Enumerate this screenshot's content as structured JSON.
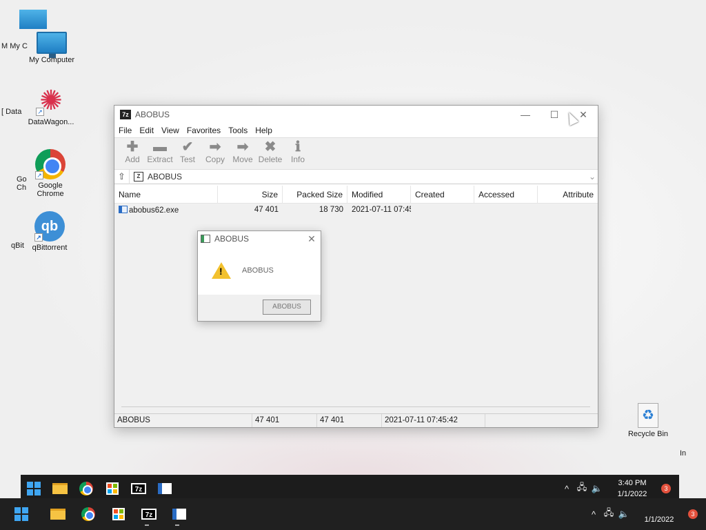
{
  "desktop": {
    "icons": [
      {
        "label": "My Computer"
      },
      {
        "label": "DataWagon..."
      },
      {
        "label": "Google Chrome"
      },
      {
        "label": "qBittorrent"
      },
      {
        "label": "Recycle Bin"
      }
    ],
    "ghost_labels": [
      "M My C",
      "[ Data",
      "Go Ch",
      "qBit",
      "In"
    ]
  },
  "window": {
    "title": "ABOBUS",
    "app_badge": "7z",
    "controls": {
      "minimize": "—",
      "maximize": "☐",
      "close": "✕"
    },
    "menu": [
      "File",
      "Edit",
      "View",
      "Favorites",
      "Tools",
      "Help"
    ],
    "toolbar": [
      {
        "label": "Add",
        "icon": "plus-icon",
        "glyph": "✚"
      },
      {
        "label": "Extract",
        "icon": "minus-icon",
        "glyph": "▬"
      },
      {
        "label": "Test",
        "icon": "check-icon",
        "glyph": "✔"
      },
      {
        "label": "Copy",
        "icon": "copy-arrow-icon",
        "glyph": "➡"
      },
      {
        "label": "Move",
        "icon": "move-arrow-icon",
        "glyph": "➡"
      },
      {
        "label": "Delete",
        "icon": "delete-x-icon",
        "glyph": "✖"
      },
      {
        "label": "Info",
        "icon": "info-icon",
        "glyph": "ℹ"
      }
    ],
    "address": {
      "path": "ABOBUS",
      "badge": "Z"
    },
    "columns": [
      "Name",
      "Size",
      "Packed Size",
      "Modified",
      "Created",
      "Accessed",
      "Attribute"
    ],
    "files": [
      {
        "name": "abobus62.exe",
        "size": "47 401",
        "packed": "18 730",
        "modified": "2021-07-11 07:45",
        "created": "",
        "accessed": "",
        "attr": ""
      }
    ],
    "status": {
      "name": "ABOBUS",
      "size": "47 401",
      "packed": "47 401",
      "modified": "2021-07-11 07:45:42"
    }
  },
  "dialog": {
    "title": "ABOBUS",
    "message": "ABOBUS",
    "button": "ABOBUS",
    "close": "✕",
    "warn_glyph": "!"
  },
  "taskbar": {
    "tray_time_top": "3:40 PM",
    "tray_date_top": "1/1/2022",
    "tray_date_bottom": "1/1/2022",
    "notifications": "3",
    "chevron": "^",
    "accent": "#3fa6f2"
  }
}
